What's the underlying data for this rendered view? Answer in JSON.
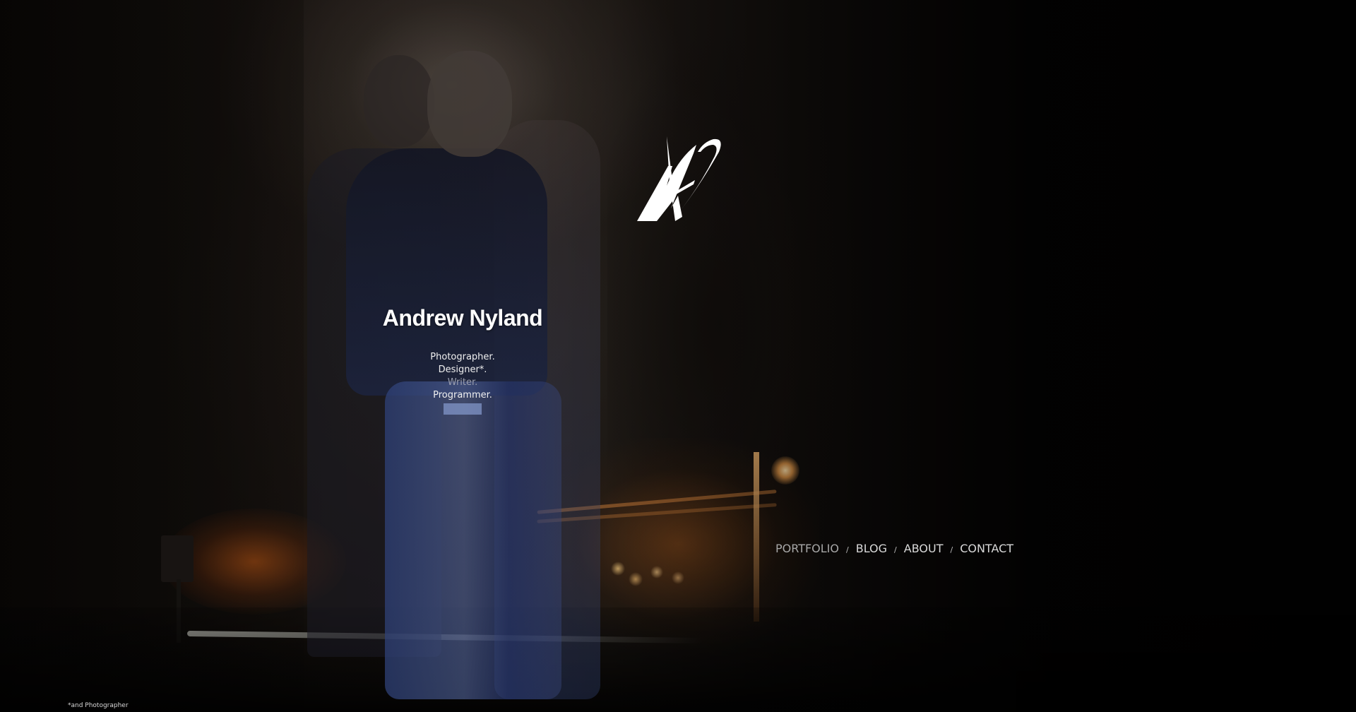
{
  "header": {
    "logo_icon": "an-monogram-logo-icon",
    "name": "Andrew Nyland"
  },
  "roles": [
    "Photographer.",
    "Designer*.",
    "Writer.",
    "Programmer."
  ],
  "nav": {
    "items": [
      {
        "label": "PORTFOLIO"
      },
      {
        "label": "BLOG"
      },
      {
        "label": "ABOUT"
      },
      {
        "label": "CONTACT"
      }
    ],
    "separator": "/"
  },
  "footnote": "*and Photographer",
  "colors": {
    "background": "#050403",
    "text": "#ffffff",
    "nav_text": "#d9d9d9",
    "highlight": "#8296c8"
  }
}
